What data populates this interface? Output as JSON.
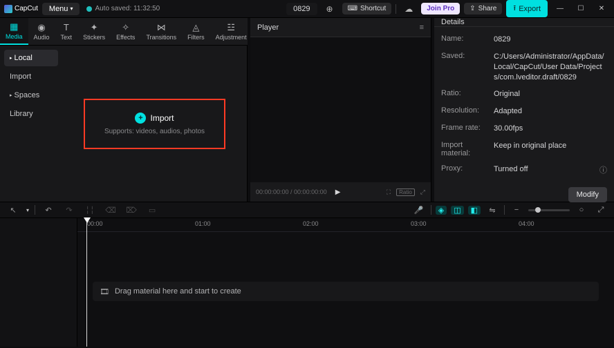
{
  "titlebar": {
    "app": "CapCut",
    "menu_label": "Menu",
    "auto_saved": "Auto saved: 11:32:50",
    "project": "0829",
    "shortcut_label": "Shortcut",
    "join_pro": "Join Pro",
    "share_label": "Share",
    "export_label": "Export"
  },
  "tabs": [
    "Media",
    "Audio",
    "Text",
    "Stickers",
    "Effects",
    "Transitions",
    "Filters",
    "Adjustment"
  ],
  "sidebar": {
    "items": [
      {
        "label": "Local",
        "expandable": true,
        "active": true
      },
      {
        "label": "Import",
        "expandable": false,
        "active": false
      },
      {
        "label": "Spaces",
        "expandable": true,
        "active": false
      },
      {
        "label": "Library",
        "expandable": false,
        "active": false
      }
    ]
  },
  "import": {
    "label": "Import",
    "hint": "Supports: videos, audios, photos"
  },
  "player": {
    "title": "Player",
    "timecode": "00:00:00:00 / 00:00:00:00",
    "ratio_label": "Ratio"
  },
  "details": {
    "title": "Details",
    "rows": [
      {
        "k": "Name:",
        "v": "0829"
      },
      {
        "k": "Saved:",
        "v": "C:/Users/Administrator/AppData/Local/CapCut/User Data/Projects/com.lveditor.draft/0829"
      },
      {
        "k": "Ratio:",
        "v": "Original"
      },
      {
        "k": "Resolution:",
        "v": "Adapted"
      },
      {
        "k": "Frame rate:",
        "v": "30.00fps"
      },
      {
        "k": "Import material:",
        "v": "Keep in original place"
      },
      {
        "k": "Proxy:",
        "v": "Turned off"
      }
    ],
    "modify": "Modify"
  },
  "timeline": {
    "ticks": [
      "00:00",
      "01:00",
      "02:00",
      "03:00",
      "04:00"
    ],
    "placeholder": "Drag material here and start to create"
  }
}
